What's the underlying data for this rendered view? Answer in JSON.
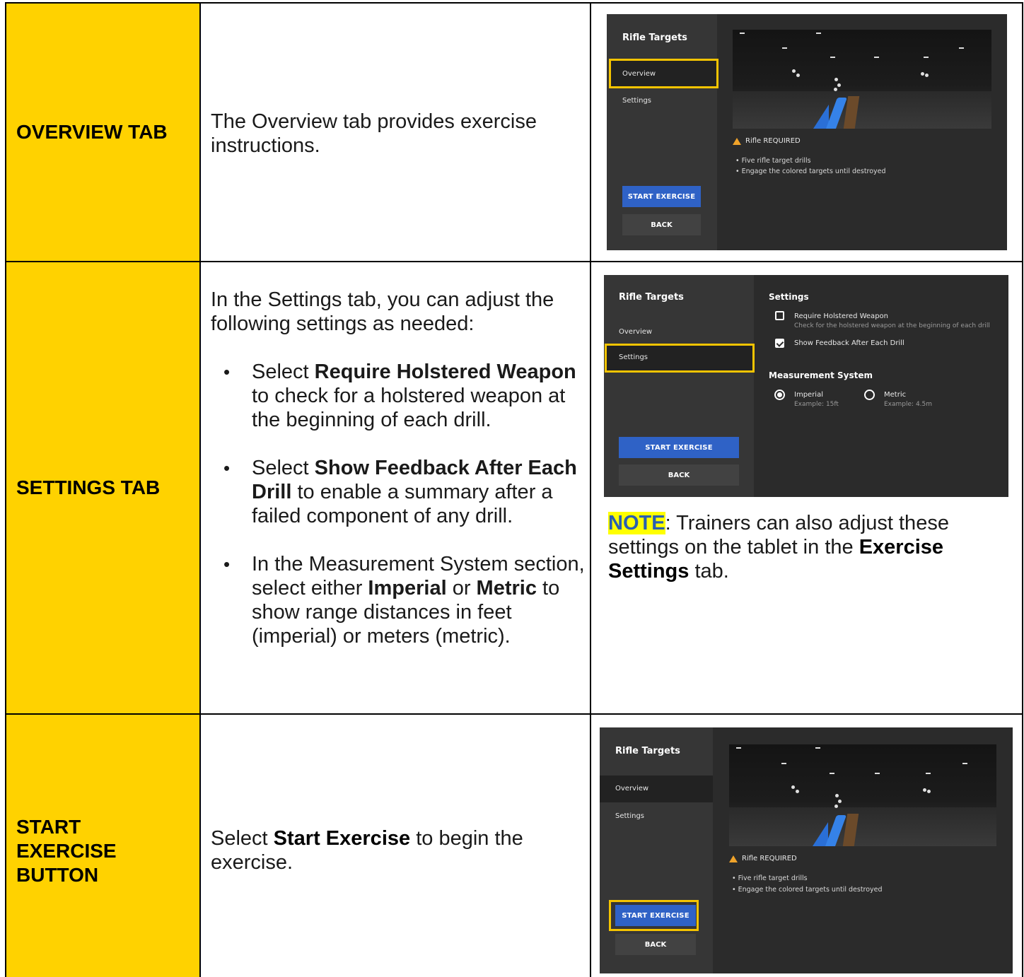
{
  "rows": [
    {
      "label": "OVERVIEW TAB",
      "description": "The Overview tab provides exercise instructions."
    },
    {
      "label": "SETTINGS TAB",
      "intro": "In the Settings tab, you can adjust the following settings as needed:",
      "bullets": [
        {
          "pre": "Select ",
          "bold": "Require Holstered Weapon",
          "post": " to check for a holstered weapon at the beginning of each drill."
        },
        {
          "pre": "Select ",
          "bold": "Show Feedback After Each Drill",
          "post": " to enable a summary after a failed component of any drill."
        },
        {
          "pre": "In the Measurement System section, select either ",
          "bold": "Imperial",
          "mid": " or ",
          "bold2": "Metric",
          "post": " to show range distances in feet (imperial) or meters (metric)."
        }
      ],
      "note": {
        "label": "NOTE",
        "text": ": Trainers can also adjust these settings on the tablet in the ",
        "bold": "Exercise Settings",
        "end": " tab."
      }
    },
    {
      "label_lines": [
        "START",
        "EXERCISE",
        "BUTTON"
      ],
      "pre": "Select ",
      "bold": "Start Exercise",
      "post": " to begin the exercise."
    }
  ],
  "app": {
    "title": "Rifle Targets",
    "tab_overview": "Overview",
    "tab_settings": "Settings",
    "start_button": "START EXERCISE",
    "back_button": "BACK",
    "requirement": "Rifle REQUIRED",
    "info": [
      "• Five rifle target drills",
      "• Engage the colored targets until destroyed"
    ],
    "settings": {
      "heading": "Settings",
      "opt1": "Require Holstered Weapon",
      "opt1_sub": "Check for the holstered weapon at the beginning of each drill",
      "opt2": "Show Feedback After Each Drill",
      "measure_heading": "Measurement System",
      "imperial": "Imperial",
      "imperial_sub": "Example: 15ft",
      "metric": "Metric",
      "metric_sub": "Example: 4.5m",
      "require_holstered_checked": false,
      "show_feedback_checked": true,
      "selected_unit": "Imperial"
    }
  },
  "colors": {
    "label_bg": "#ffd200",
    "highlight": "#f5c400",
    "start_btn": "#2f62c6"
  }
}
